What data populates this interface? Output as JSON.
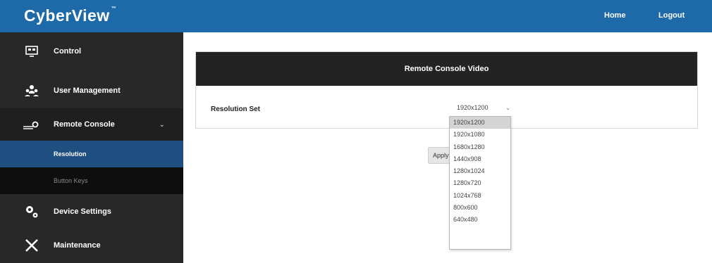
{
  "header": {
    "logo_text": "CyberView",
    "logo_tm": "™",
    "home_label": "Home",
    "logout_label": "Logout",
    "bar_color": "#1e6aa8"
  },
  "sidebar": {
    "items": [
      {
        "label": "Control",
        "icon": "monitor-icon"
      },
      {
        "label": "User Management",
        "icon": "users-icon"
      },
      {
        "label": "Remote Console",
        "icon": "remote-console-icon",
        "expanded": true
      },
      {
        "label": "Device Settings",
        "icon": "gears-icon"
      },
      {
        "label": "Maintenance",
        "icon": "tools-icon"
      }
    ],
    "sub_items": [
      {
        "label": "Resolution",
        "active": true
      },
      {
        "label": "Button Keys",
        "active": false
      }
    ],
    "active_color": "#1e4f80"
  },
  "main": {
    "panel_title": "Remote Console Video",
    "resolution_label": "Resolution Set",
    "selected_value": "1920x1200",
    "apply_label": "Apply",
    "options": [
      "1920x1200",
      "1920x1080",
      "1680x1280",
      "1440x908",
      "1280x1024",
      "1280x720",
      "1024x768",
      "800x600",
      "640x480"
    ]
  }
}
